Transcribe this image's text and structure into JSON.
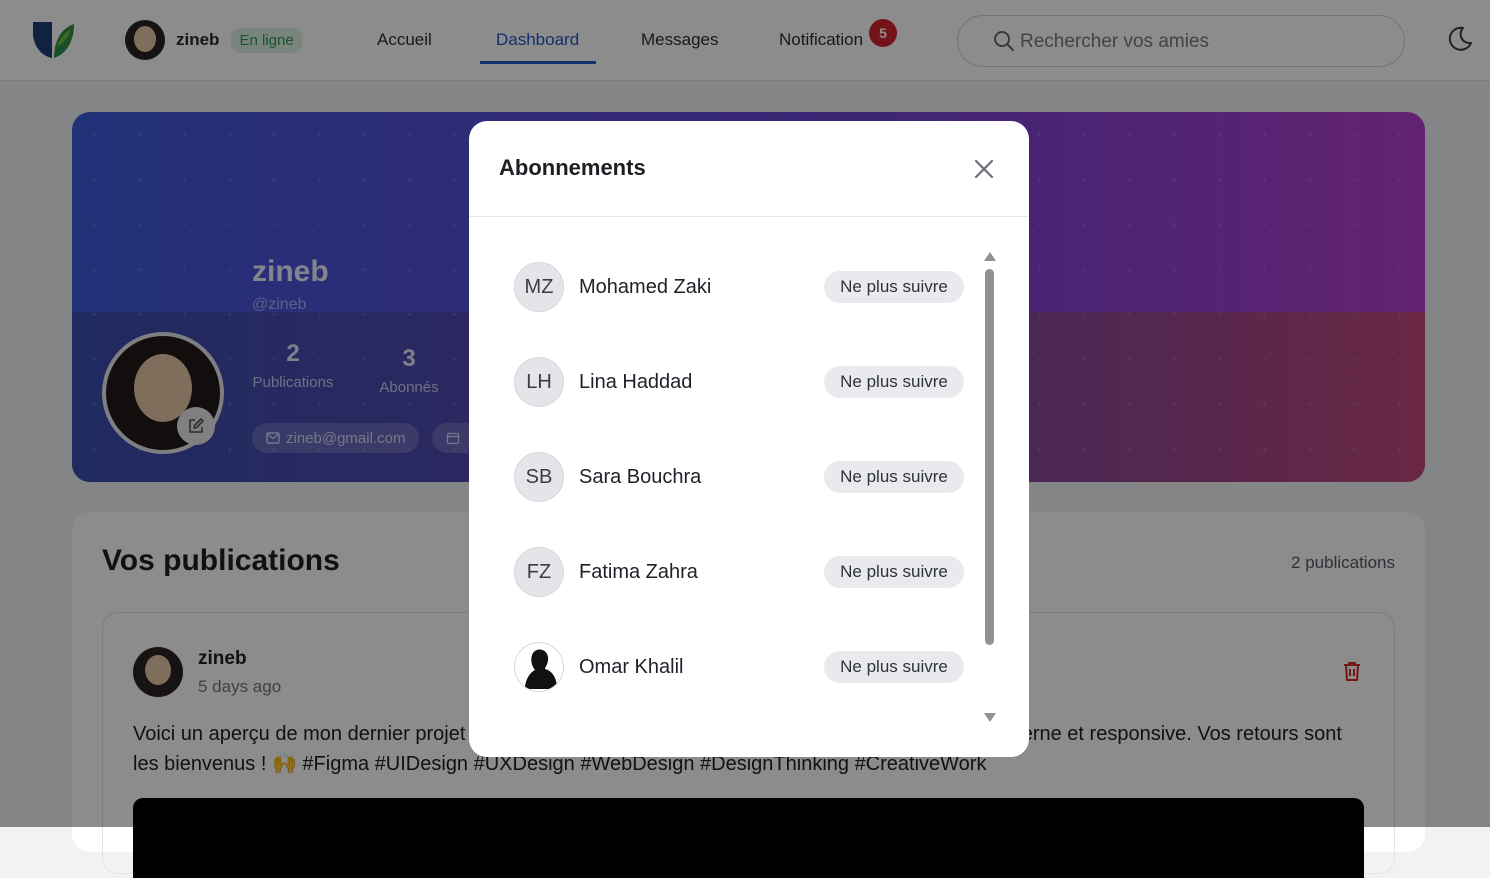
{
  "header": {
    "user_name": "zineb",
    "status": "En ligne",
    "nav": [
      {
        "label": "Accueil"
      },
      {
        "label": "Dashboard"
      },
      {
        "label": "Messages"
      },
      {
        "label": "Notification"
      }
    ],
    "active_nav": "Dashboard",
    "notification_count": "5",
    "search_placeholder": "Rechercher vos amies",
    "icons": {
      "logo": "app-logo",
      "search": "search-icon",
      "theme": "moon-icon"
    },
    "colors": {
      "accent": "#2457c6",
      "notif": "#d2262f",
      "online": "#2f9b53"
    }
  },
  "profile": {
    "name": "zineb",
    "handle": "@zineb",
    "stats": [
      {
        "value": "2",
        "label": "Publications"
      },
      {
        "value": "3",
        "label": "Abonnés"
      }
    ],
    "email": "zineb@gmail.com"
  },
  "publications": {
    "title": "Vos publications",
    "count_text": "2 publications",
    "post": {
      "author": "zineb",
      "time": "5 days ago",
      "text": "Voici un aperçu de mon dernier projet de design UI/UX sur Figma. J'ai voulu créer une interface moderne et responsive. Vos retours sont les bienvenus ! 🙌 #Figma #UIDesign #UXDesign #WebDesign #DesignThinking #CreativeWork"
    }
  },
  "modal": {
    "title": "Abonnements",
    "close_icon": "close-icon",
    "items": [
      {
        "initials": "MZ",
        "name": "Mohamed Zaki",
        "action": "Ne plus suivre"
      },
      {
        "initials": "LH",
        "name": "Lina Haddad",
        "action": "Ne plus suivre"
      },
      {
        "initials": "SB",
        "name": "Sara Bouchra",
        "action": "Ne plus suivre"
      },
      {
        "initials": "FZ",
        "name": "Fatima Zahra",
        "action": "Ne plus suivre"
      },
      {
        "initials": "",
        "name": "Omar Khalil",
        "action": "Ne plus suivre"
      }
    ]
  }
}
